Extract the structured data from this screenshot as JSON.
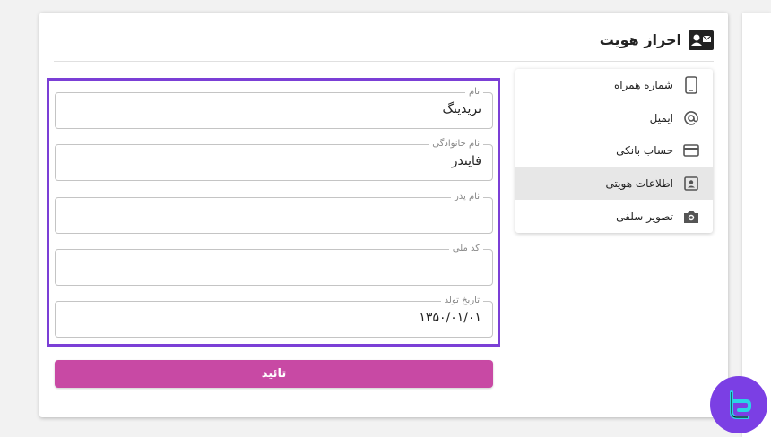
{
  "header": {
    "title": "احراز هویت",
    "icon": "id-card-icon"
  },
  "menu": {
    "items": [
      {
        "label": "شماره همراه",
        "icon": "phone-icon",
        "active": false
      },
      {
        "label": "ایمیل",
        "icon": "at-icon",
        "active": false
      },
      {
        "label": "حساب بانکی",
        "icon": "credit-card-icon",
        "active": false
      },
      {
        "label": "اطلاعات هویتی",
        "icon": "profile-card-icon",
        "active": true
      },
      {
        "label": "تصویر سلفی",
        "icon": "camera-icon",
        "active": false
      }
    ]
  },
  "form": {
    "fields": [
      {
        "label": "نام",
        "value": "تریدینگ"
      },
      {
        "label": "نام خانوادگی",
        "value": "فایندر"
      },
      {
        "label": "نام پدر",
        "value": ""
      },
      {
        "label": "کد ملی",
        "value": ""
      },
      {
        "label": "تاریخ تولد",
        "value": "۱۳۵۰/۰۱/۰۱"
      }
    ],
    "submit_label": "تائید"
  },
  "colors": {
    "accent_button": "#c849a4",
    "highlight_border": "#7b3fd6",
    "logo_bg": "#7b3fe4"
  }
}
